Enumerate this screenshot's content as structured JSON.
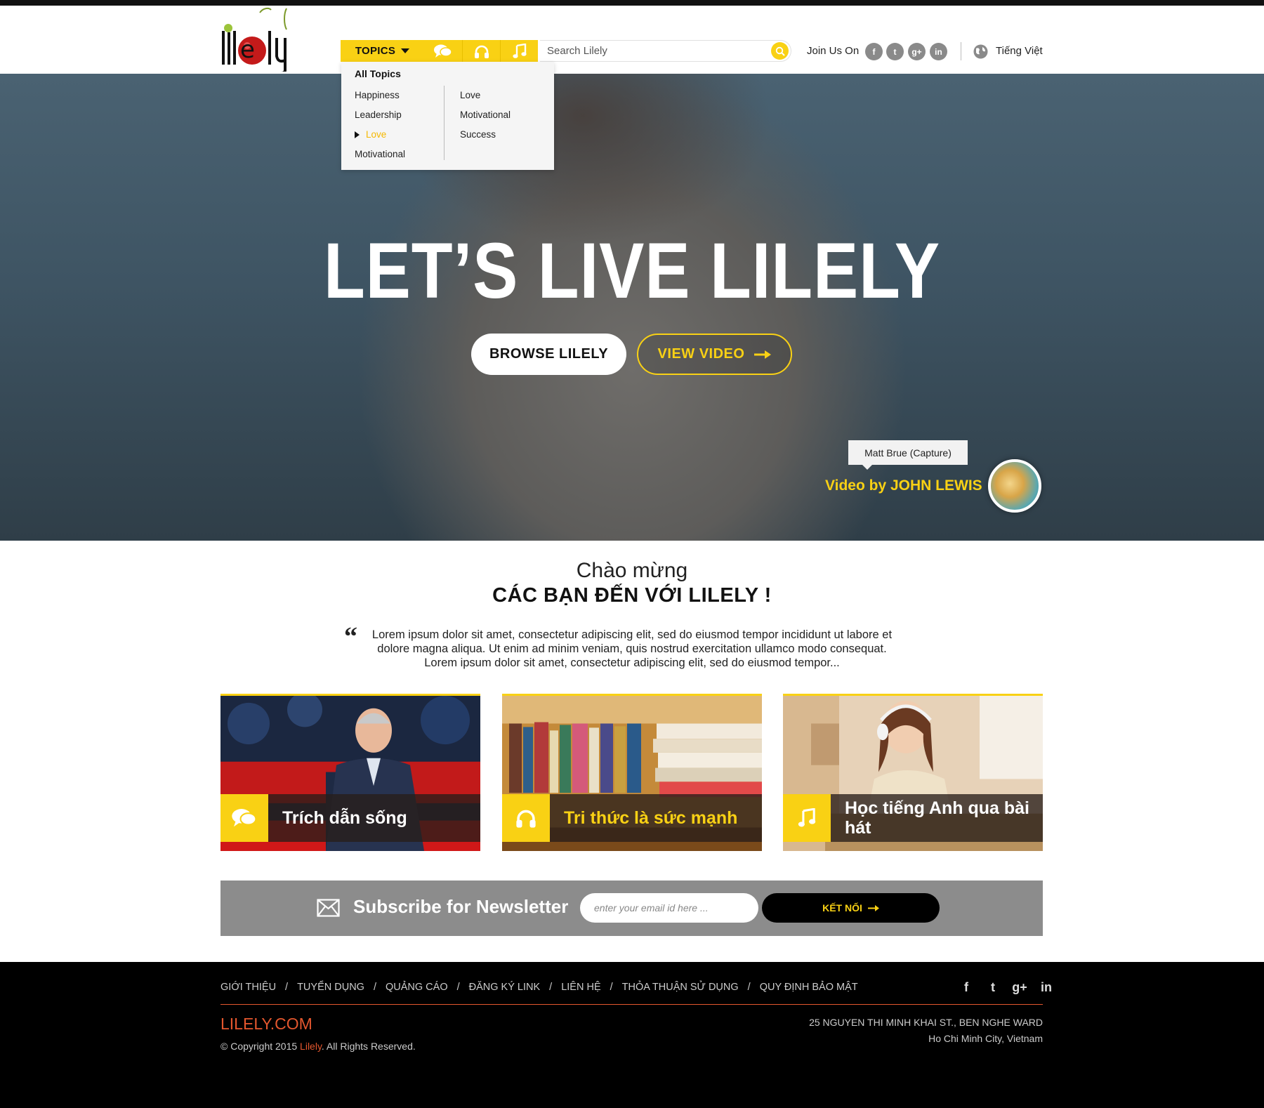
{
  "brand": {
    "logo_text": "lilely"
  },
  "nav": {
    "topics_label": "TOPICS",
    "category_icons": [
      "chat-bubbles-icon",
      "headphones-icon",
      "music-note-icon"
    ],
    "search_placeholder": "Search Lilely",
    "join_label": "Join Us On",
    "social": [
      "f",
      "t",
      "g+",
      "in"
    ],
    "language_label": "Tiếng Việt"
  },
  "dropdown": {
    "all_label": "All Topics",
    "col1": [
      "Happiness",
      "Leadership",
      "Love",
      "Motivational"
    ],
    "col2": [
      "Love",
      "Motivational",
      "Success"
    ],
    "active_item": "Love"
  },
  "hero": {
    "title": "LET’S LIVE LILELY",
    "browse_label": "BROWSE LILELY",
    "video_label": "VIEW VIDEO",
    "credit_tooltip": "Matt Brue (Capture)",
    "credit_prefix": "Video by",
    "credit_name": "JOHN LEWIS"
  },
  "welcome": {
    "line1": "Chào mừng",
    "line2": "CÁC BẠN ĐẾN VỚI LILELY !",
    "quote_mark": "“",
    "quote": "Lorem ipsum dolor sit amet, consectetur adipiscing elit, sed do eiusmod tempor incididunt ut labore et dolore magna aliqua. Ut enim ad minim veniam, quis nostrud exercitation ullamco modo consequat. Lorem ipsum dolor sit amet, consectetur adipiscing elit, sed do eiusmod tempor..."
  },
  "cards": [
    {
      "title": "Trích dẫn sống",
      "icon": "chat-bubbles-icon"
    },
    {
      "title": "Tri thức là sức mạnh",
      "icon": "headphones-icon"
    },
    {
      "title": "Học tiếng Anh qua bài hát",
      "icon": "music-note-icon"
    }
  ],
  "newsletter": {
    "label": "Subscribe for Newsletter",
    "placeholder": "enter your email id here ...",
    "button_label": "KẾT NỐI"
  },
  "footer": {
    "links": [
      "GIỚI THIỆU",
      "TUYỂN DỤNG",
      "QUẢNG CÁO",
      "ĐĂNG KÝ LINK",
      "LIÊN HỆ",
      "THỎA THUẬN SỬ DỤNG",
      "QUY ĐỊNH BẢO MẬT"
    ],
    "separator": "/",
    "social": [
      "f",
      "t",
      "g+",
      "in"
    ],
    "brand": "LILELY.COM",
    "copyright_prefix": "© Copyright 2015",
    "copyright_brand": "Lilely",
    "copyright_suffix": ". All Rights Reserved.",
    "address_line1": "25 NGUYEN THI MINH KHAI ST., BEN NGHE WARD",
    "address_line2": "Ho Chi Minh City, Vietnam"
  },
  "colors": {
    "accent": "#f9d114",
    "footer_accent": "#e4572e",
    "newsletter_bg": "#8c8c8c"
  }
}
